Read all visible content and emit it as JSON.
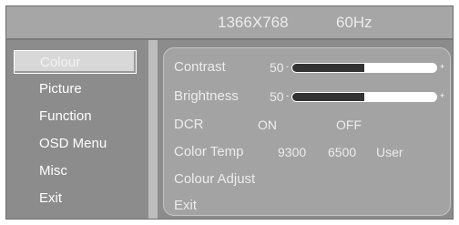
{
  "header": {
    "resolution": "1366X768",
    "refresh": "60Hz"
  },
  "menu": {
    "items": [
      {
        "label": "Colour",
        "selected": true
      },
      {
        "label": "Picture"
      },
      {
        "label": "Function"
      },
      {
        "label": "OSD Menu"
      },
      {
        "label": "Misc"
      },
      {
        "label": "Exit"
      }
    ]
  },
  "panel": {
    "contrast": {
      "label": "Contrast",
      "value": "50",
      "level": 50,
      "minus": "-",
      "plus": "+"
    },
    "brightness": {
      "label": "Brightness",
      "value": "50",
      "level": 50,
      "minus": "-",
      "plus": "+"
    },
    "dcr": {
      "label": "DCR",
      "on": "ON",
      "off": "OFF"
    },
    "color_temp": {
      "label": "Color Temp",
      "opt1": "9300",
      "opt2": "6500",
      "opt3": "User"
    },
    "colour_adjust": {
      "label": "Colour Adjust"
    },
    "exit": {
      "label": "Exit"
    }
  },
  "colors": {
    "background": "#8c8c8c",
    "panel": "#a3a3a3",
    "text": "#ececec"
  }
}
